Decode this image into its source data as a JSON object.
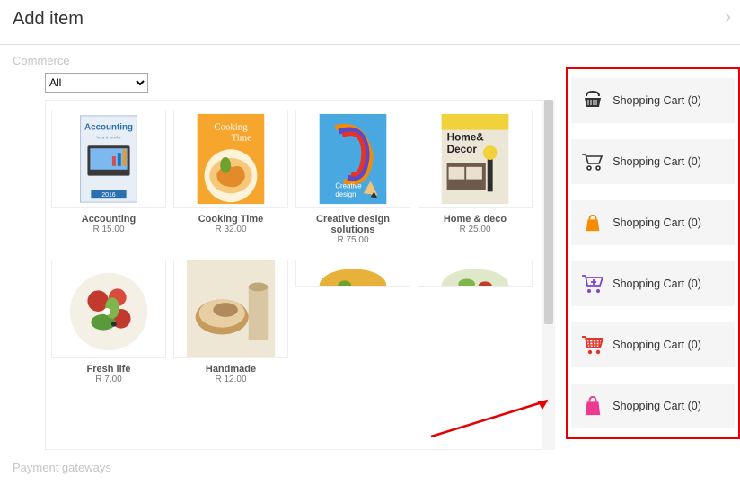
{
  "header": {
    "title": "Add item"
  },
  "section_commerce": "Commerce",
  "filter": {
    "selected": "All"
  },
  "products": [
    {
      "title": "Accounting",
      "price": "R 15.00"
    },
    {
      "title": "Cooking Time",
      "price": "R 32.00"
    },
    {
      "title": "Creative design solutions",
      "price": "R 75.00"
    },
    {
      "title": "Home & deco",
      "price": "R 25.00"
    },
    {
      "title": "Fresh life",
      "price": "R 7.00"
    },
    {
      "title": "Handmade",
      "price": "R 12.00"
    }
  ],
  "cart_widgets": [
    {
      "label": "Shopping Cart (0)",
      "icon": "basket",
      "color": "#333333"
    },
    {
      "label": "Shopping Cart (0)",
      "icon": "trolley-outline",
      "color": "#333333"
    },
    {
      "label": "Shopping Cart (0)",
      "icon": "bag",
      "color": "#f58b00"
    },
    {
      "label": "Shopping Cart (0)",
      "icon": "trolley-plus",
      "color": "#7b45d6"
    },
    {
      "label": "Shopping Cart (0)",
      "icon": "trolley-fill",
      "color": "#e6332a"
    },
    {
      "label": "Shopping Cart (0)",
      "icon": "bag-fill",
      "color": "#ec3b8f"
    }
  ],
  "section_payment": "Payment gateways"
}
